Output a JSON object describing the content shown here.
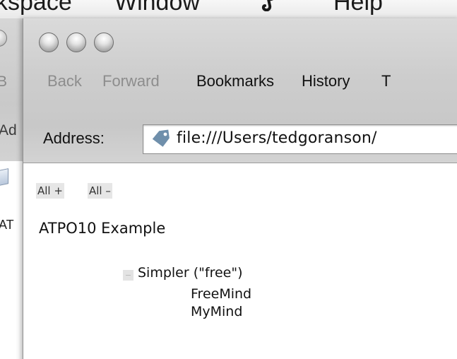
{
  "menubar": {
    "items": [
      {
        "label": "kspace",
        "icon": ""
      },
      {
        "label": "Window",
        "icon": ""
      },
      {
        "label": "",
        "icon": "script-icon"
      },
      {
        "label": "Help",
        "icon": ""
      }
    ]
  },
  "background_window": {
    "back_fragment": "B",
    "address_fragment": "Ad",
    "content_fragment": "AT"
  },
  "window": {
    "nav": {
      "back": "Back",
      "forward": "Forward",
      "bookmarks": "Bookmarks",
      "history": "History",
      "tools": "T"
    },
    "address": {
      "label": "Address:",
      "url": "file:///Users/tedgoranson/"
    }
  },
  "page": {
    "expand_all": "All +",
    "collapse_all": "All –",
    "title": "ATPO10 Example",
    "outline": {
      "label": "Simpler (\"free\")",
      "expanded": true,
      "children": [
        "FreeMind",
        "MyMind"
      ]
    }
  },
  "colors": {
    "chrome": "#cdcdcd",
    "disabled_text": "#8d8d8d",
    "control_bg": "#e6e6e6"
  }
}
